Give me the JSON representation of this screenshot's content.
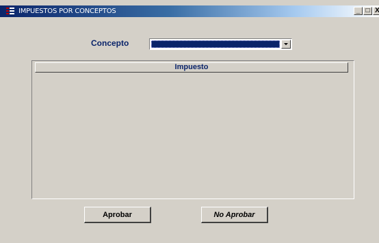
{
  "window": {
    "title": "IMPUESTOS POR CONCEPTOS",
    "icon": "app-icon",
    "controls": {
      "minimize": "_",
      "maximize": "□",
      "close": "X"
    }
  },
  "form": {
    "concepto_label": "Concepto",
    "concepto_value": ""
  },
  "grid": {
    "columns": [
      "Impuesto"
    ],
    "rows": []
  },
  "buttons": {
    "aprobar": "Aprobar",
    "no_aprobar": "No Aprobar"
  },
  "colors": {
    "label": "#0a246a",
    "face": "#d4d0c8",
    "titlebar_start": "#0a246a",
    "selection": "#0a246a"
  }
}
